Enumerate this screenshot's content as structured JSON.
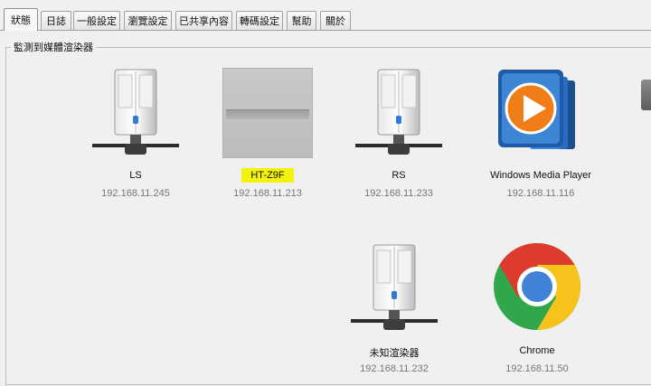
{
  "tabs": [
    {
      "label": "狀態",
      "active": true
    },
    {
      "label": "日誌",
      "active": false
    },
    {
      "label": "一般設定",
      "active": false
    },
    {
      "label": "瀏覽設定",
      "active": false
    },
    {
      "label": "已共享內容",
      "active": false
    },
    {
      "label": "轉碼設定",
      "active": false
    },
    {
      "label": "幫助",
      "active": false
    },
    {
      "label": "關於",
      "active": false
    }
  ],
  "group_title": "監測到媒體渲染器",
  "devices": [
    {
      "name": "LS",
      "ip": "192.168.11.245",
      "icon": "server-tower-icon"
    },
    {
      "name": "HT-Z9F",
      "ip": "192.168.11.213",
      "icon": "gray-placeholder-icon",
      "highlighted": true
    },
    {
      "name": "RS",
      "ip": "192.168.11.233",
      "icon": "server-tower-icon"
    },
    {
      "name": "Windows Media Player",
      "ip": "192.168.11.116",
      "icon": "windows-media-player-icon"
    },
    {
      "name": "未知渲染器",
      "ip": "192.168.11.232",
      "icon": "server-tower-icon"
    },
    {
      "name": "Chrome",
      "ip": "192.168.11.50",
      "icon": "chrome-icon"
    }
  ],
  "colors": {
    "highlight": "#f2f20a",
    "ip_text": "#777777",
    "background": "#f0f0f0"
  }
}
